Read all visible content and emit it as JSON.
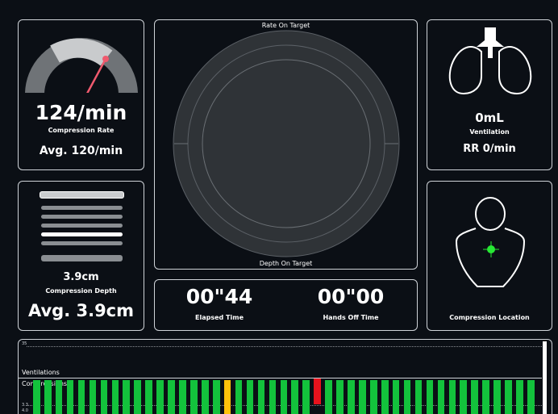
{
  "colors": {
    "background": "#0b0f15",
    "panel_border": "#cfd3d8",
    "gauge_track": "#6f7377",
    "gauge_fill": "#c9cbcd",
    "needle": "#f05a6e",
    "compression_bar": "#13c23c",
    "highlight_yellow": "#ffc20a",
    "highlight_red": "#e8121d",
    "target_dot": "#27e834"
  },
  "rate_panel": {
    "value": "124/min",
    "label": "Compression Rate",
    "average": "Avg. 120/min"
  },
  "target_panel": {
    "top_label": "Rate On Target",
    "bottom_label": "Depth On Target"
  },
  "ventilation_panel": {
    "icon": "lungs-icon",
    "value": "0mL",
    "label": "Ventilation",
    "rate": "RR 0/min"
  },
  "depth_panel": {
    "value": "3.9cm",
    "label": "Compression Depth",
    "average": "Avg. 3.9cm"
  },
  "timer_panel": {
    "elapsed_value": "00\"44",
    "elapsed_label": "Elapsed Time",
    "handsoff_value": "00\"00",
    "handsoff_label": "Hands Off Time"
  },
  "location_panel": {
    "icon": "torso-icon",
    "label": "Compression Location"
  },
  "timeline": {
    "scale_top": "35",
    "ventilations_label": "Ventilations",
    "compressions_label": "Compressions",
    "scale_bottom_1": "3.3",
    "scale_bottom_2": "4.0",
    "bars": [
      "g",
      "g",
      "g",
      "g",
      "g",
      "g",
      "g",
      "g",
      "g",
      "g",
      "g",
      "g",
      "g",
      "g",
      "g",
      "g",
      "g",
      "y",
      "g",
      "g",
      "g",
      "g",
      "g",
      "g",
      "g",
      "r",
      "g",
      "g",
      "g",
      "g",
      "g",
      "g",
      "g",
      "g",
      "g",
      "g",
      "g",
      "g",
      "g",
      "g",
      "g",
      "g",
      "g",
      "g",
      "g"
    ]
  }
}
